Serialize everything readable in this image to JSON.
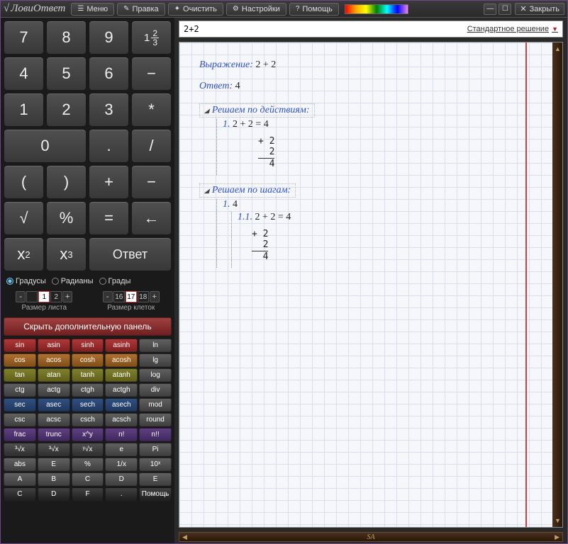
{
  "app": {
    "title": "ЛовиОтвет"
  },
  "menu": {
    "menu": "Меню",
    "edit": "Правка",
    "clear": "Очистить",
    "settings": "Настройки",
    "help": "Помощь",
    "close": "Закрыть"
  },
  "keypad": {
    "r1": [
      "7",
      "8",
      "9"
    ],
    "frac_whole": "1",
    "frac_num": "2",
    "frac_den": "3",
    "r2": [
      "4",
      "5",
      "6",
      "−"
    ],
    "r3": [
      "1",
      "2",
      "3",
      "*"
    ],
    "r4": [
      "0",
      ".",
      "/"
    ],
    "r5": [
      "(",
      ")",
      "+",
      "−"
    ],
    "r6": [
      "√",
      "%",
      "=",
      "←"
    ],
    "answer": "Ответ"
  },
  "angle": {
    "degrees": "Градусы",
    "radians": "Радианы",
    "grads": "Грады"
  },
  "sheet": {
    "minus": "-",
    "plus": "+",
    "size_vals": [
      "",
      "1",
      "2"
    ],
    "size_label": "Размер листа",
    "cell_vals": [
      "16",
      "17",
      "18"
    ],
    "cell_label": "Размер клеток"
  },
  "hide_panel": "Скрыть дополнительную панель",
  "funcs": [
    [
      "sin",
      "asin",
      "sinh",
      "asinh",
      "ln"
    ],
    [
      "cos",
      "acos",
      "cosh",
      "acosh",
      "lg"
    ],
    [
      "tan",
      "atan",
      "tanh",
      "atanh",
      "log"
    ],
    [
      "ctg",
      "actg",
      "ctgh",
      "actgh",
      "div"
    ],
    [
      "sec",
      "asec",
      "sech",
      "asech",
      "mod"
    ],
    [
      "csc",
      "acsc",
      "csch",
      "acsch",
      "round"
    ],
    [
      "frac",
      "trunc",
      "x^y",
      "n!",
      "n!!"
    ],
    [
      "³√x",
      "³√x",
      "ʸ√x",
      "e",
      "Pi"
    ],
    [
      "abs",
      "E",
      "%",
      "1/x",
      "10ˣ"
    ],
    [
      "A",
      "B",
      "C",
      "D",
      "E"
    ],
    [
      "C",
      "D",
      "F",
      ".",
      "Помощь"
    ]
  ],
  "func_colors": [
    [
      "red",
      "red",
      "red",
      "red",
      "grey"
    ],
    [
      "orange",
      "orange",
      "orange",
      "orange",
      "grey"
    ],
    [
      "olive",
      "olive",
      "olive",
      "olive",
      "grey"
    ],
    [
      "grey",
      "grey",
      "grey",
      "grey",
      "grey"
    ],
    [
      "blue",
      "blue",
      "blue",
      "blue",
      "grey"
    ],
    [
      "grey",
      "grey",
      "grey",
      "grey",
      "grey"
    ],
    [
      "purple",
      "purple",
      "purple",
      "purple",
      "purple"
    ],
    [
      "dgrey",
      "dgrey",
      "dgrey",
      "grey",
      "grey"
    ],
    [
      "grey",
      "grey",
      "grey",
      "grey",
      "grey"
    ],
    [
      "grey",
      "grey",
      "grey",
      "grey",
      "grey"
    ],
    [
      "black",
      "black",
      "black",
      "black",
      "black"
    ]
  ],
  "input": {
    "expr": "2+2",
    "soltype": "Стандартное решение"
  },
  "solution": {
    "expr_label": "Выражение:",
    "expr": "2 + 2",
    "ans_label": "Ответ:",
    "ans": "4",
    "by_actions": "Решаем по действиям:",
    "action1_num": "1.",
    "action1": "2 + 2 = 4",
    "col_op": "+",
    "col_a": "2",
    "col_b": "2",
    "col_r": "4",
    "by_steps": "Решаем по шагам:",
    "step1_num": "1.",
    "step1": "4",
    "step11_num": "1.1.",
    "step11": "2 + 2 = 4"
  },
  "footer": {
    "brand": "SA"
  }
}
